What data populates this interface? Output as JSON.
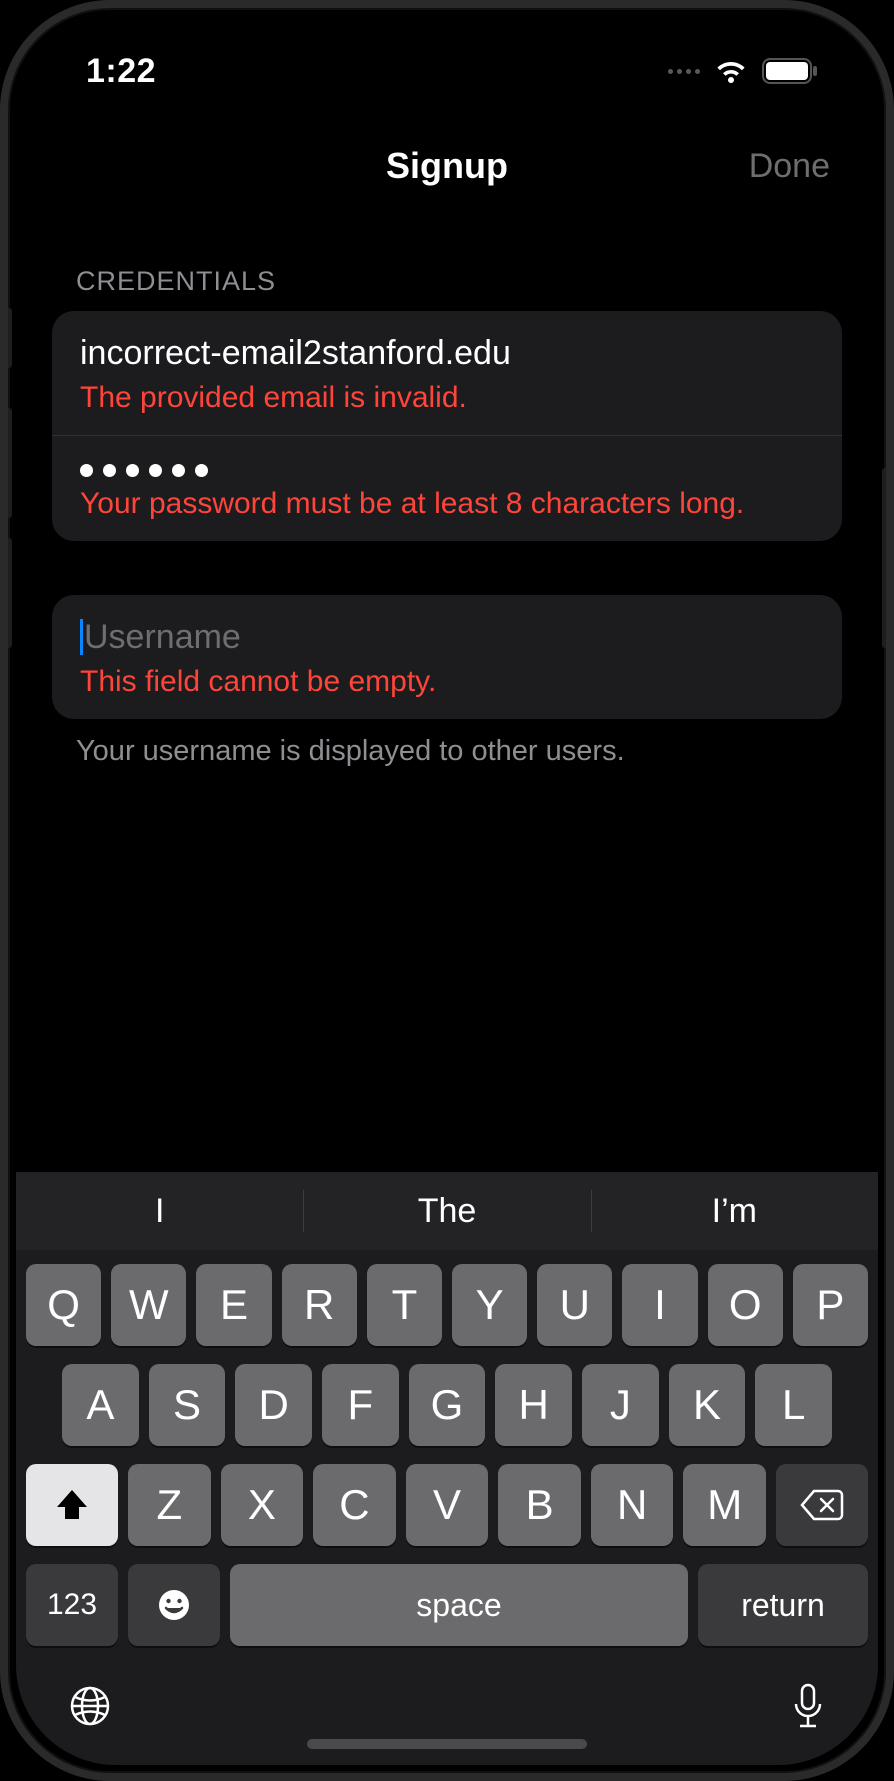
{
  "status": {
    "time": "1:22"
  },
  "nav": {
    "title": "Signup",
    "done": "Done"
  },
  "sections": {
    "credentials_header": "CREDENTIALS",
    "email_value": "incorrect-email2stanford.edu",
    "email_error": "The provided email is invalid.",
    "password_dot_count": 6,
    "password_error": "Your password must be at least 8 characters long.",
    "username_value": "",
    "username_placeholder": "Username",
    "username_error": "This field cannot be empty.",
    "username_footer": "Your username is displayed to other users."
  },
  "keyboard": {
    "suggestions": [
      "I",
      "The",
      "I’m"
    ],
    "row1": [
      "Q",
      "W",
      "E",
      "R",
      "T",
      "Y",
      "U",
      "I",
      "O",
      "P"
    ],
    "row2": [
      "A",
      "S",
      "D",
      "F",
      "G",
      "H",
      "J",
      "K",
      "L"
    ],
    "row3": [
      "Z",
      "X",
      "C",
      "V",
      "B",
      "N",
      "M"
    ],
    "mode_key": "123",
    "space_key": "space",
    "return_key": "return"
  }
}
